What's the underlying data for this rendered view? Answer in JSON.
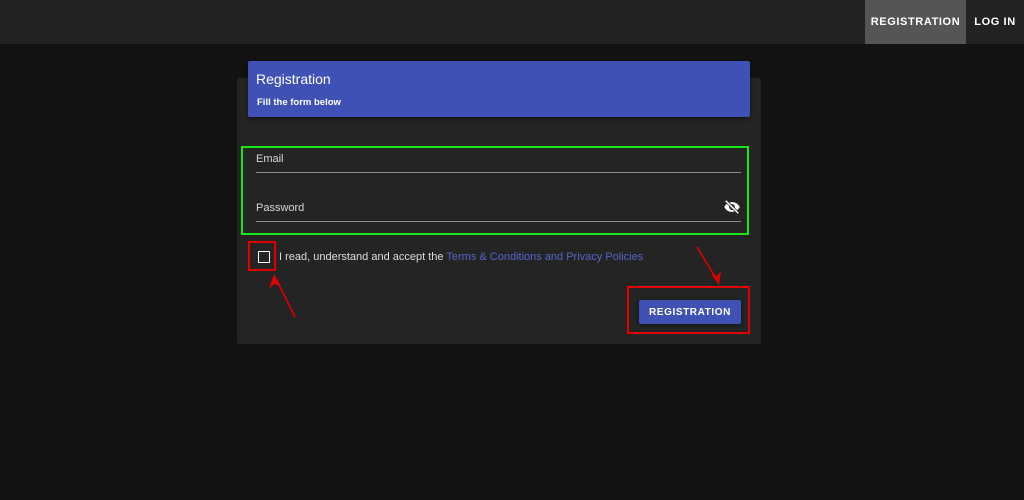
{
  "nav": {
    "registration_label": "REGISTRATION",
    "login_label": "LOG IN"
  },
  "form": {
    "title": "Registration",
    "subtitle": "Fill the form below",
    "email_label": "Email",
    "password_label": "Password",
    "password_toggle_icon": "eye-off-icon",
    "checkbox_checked": false,
    "terms_prefix": "I read, understand and accept the ",
    "terms_link": "Terms & Conditions and Privacy Policies",
    "submit_label": "REGISTRATION"
  },
  "colors": {
    "primary": "#3f51b5",
    "link": "#5266c9",
    "annotation_green": "#19e619",
    "annotation_red": "#e00000",
    "background": "#121212",
    "card": "#242424",
    "topbar": "#222222"
  }
}
